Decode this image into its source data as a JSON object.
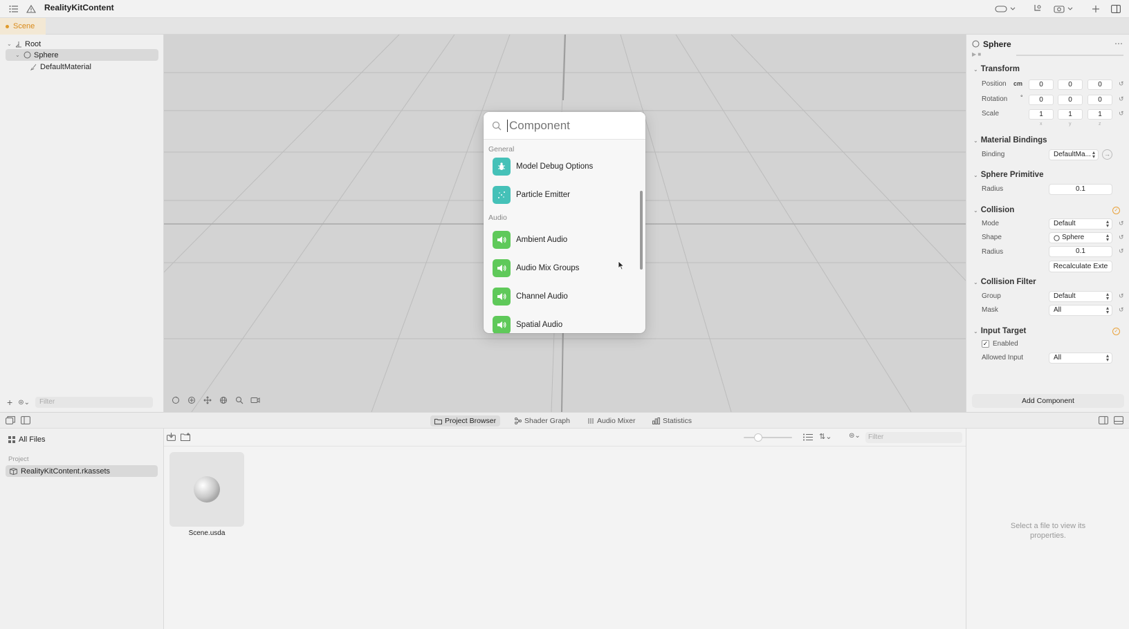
{
  "window": {
    "title": "RealityKitContent"
  },
  "scene_tab": {
    "label": "Scene"
  },
  "outline": {
    "items": [
      {
        "label": "Root"
      },
      {
        "label": "Sphere"
      },
      {
        "label": "DefaultMaterial"
      }
    ],
    "filter_placeholder": "Filter"
  },
  "popup": {
    "search_placeholder": "Component",
    "sections": [
      {
        "title": "General",
        "items": [
          "Model Debug Options",
          "Particle Emitter"
        ]
      },
      {
        "title": "Audio",
        "items": [
          "Ambient Audio",
          "Audio Mix Groups",
          "Channel Audio",
          "Spatial Audio"
        ]
      }
    ]
  },
  "inspector": {
    "entity_name": "Sphere",
    "transform": {
      "title": "Transform",
      "position_label": "Position",
      "position_unit": "cm",
      "position": [
        "0",
        "0",
        "0"
      ],
      "rotation_label": "Rotation",
      "rotation_unit": "°",
      "rotation": [
        "0",
        "0",
        "0"
      ],
      "scale_label": "Scale",
      "scale": [
        "1",
        "1",
        "1"
      ],
      "axes": [
        "x",
        "y",
        "z"
      ]
    },
    "material_bindings": {
      "title": "Material Bindings",
      "binding_label": "Binding",
      "binding_value": "DefaultMa..."
    },
    "sphere_primitive": {
      "title": "Sphere Primitive",
      "radius_label": "Radius",
      "radius_value": "0.1"
    },
    "collision": {
      "title": "Collision",
      "mode_label": "Mode",
      "mode_value": "Default",
      "shape_label": "Shape",
      "shape_value": "Sphere",
      "radius_label": "Radius",
      "radius_value": "0.1",
      "recalc_button": "Recalculate Exte"
    },
    "collision_filter": {
      "title": "Collision Filter",
      "group_label": "Group",
      "group_value": "Default",
      "mask_label": "Mask",
      "mask_value": "All"
    },
    "input_target": {
      "title": "Input Target",
      "enabled_label": "Enabled",
      "enabled": true,
      "allowed_input_label": "Allowed Input",
      "allowed_input_value": "All"
    },
    "add_component": "Add Component"
  },
  "bottom_tabs": [
    "Project Browser",
    "Shader Graph",
    "Audio Mixer",
    "Statistics"
  ],
  "files": {
    "all_files": "All Files",
    "project_header": "Project",
    "project_item": "RealityKitContent.rkassets",
    "filter_placeholder": "Filter",
    "asset_name": "Scene.usda",
    "empty_props": "Select a file to view its properties."
  },
  "colors": {
    "accent_orange": "#e09a2b",
    "teal_icon": "#45c1b8",
    "green_icon": "#5fc95a",
    "viewport_bg": "#d3d3d3"
  }
}
